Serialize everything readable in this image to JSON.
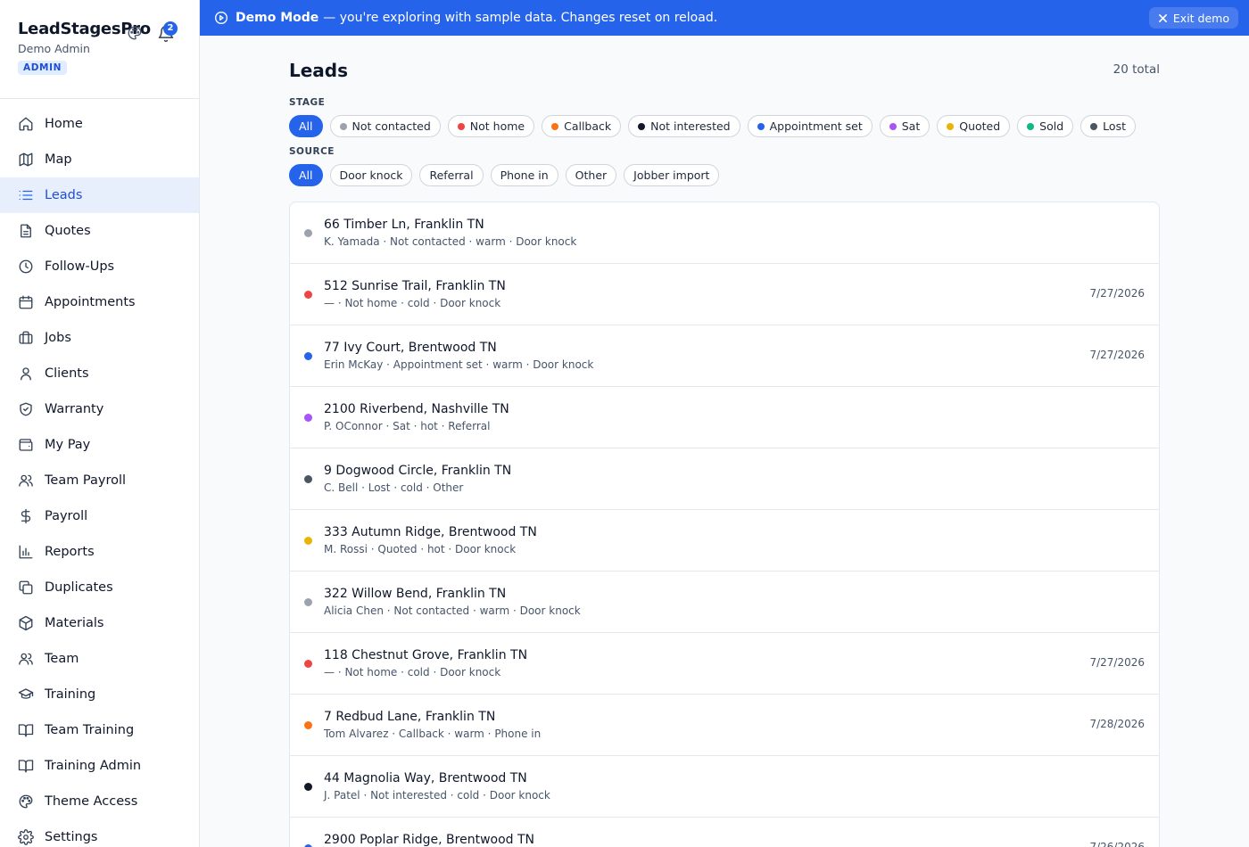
{
  "brand": {
    "title": "LeadStagesPro",
    "user": "Demo Admin",
    "role": "ADMIN",
    "notifications": "2"
  },
  "nav": [
    {
      "label": "Home",
      "icon": "home-icon"
    },
    {
      "label": "Map",
      "icon": "map-icon"
    },
    {
      "label": "Leads",
      "icon": "list-icon",
      "active": true
    },
    {
      "label": "Quotes",
      "icon": "document-icon"
    },
    {
      "label": "Follow-Ups",
      "icon": "clock-icon"
    },
    {
      "label": "Appointments",
      "icon": "calendar-icon"
    },
    {
      "label": "Jobs",
      "icon": "briefcase-icon"
    },
    {
      "label": "Clients",
      "icon": "user-icon"
    },
    {
      "label": "Warranty",
      "icon": "shield-check-icon"
    },
    {
      "label": "My Pay",
      "icon": "wallet-icon"
    },
    {
      "label": "Team Payroll",
      "icon": "users-icon"
    },
    {
      "label": "Payroll",
      "icon": "dollar-icon"
    },
    {
      "label": "Reports",
      "icon": "bar-chart-icon"
    },
    {
      "label": "Duplicates",
      "icon": "copy-icon"
    },
    {
      "label": "Materials",
      "icon": "package-icon"
    },
    {
      "label": "Team",
      "icon": "users-icon"
    },
    {
      "label": "Training",
      "icon": "graduation-cap-icon"
    },
    {
      "label": "Team Training",
      "icon": "book-open-icon"
    },
    {
      "label": "Training Admin",
      "icon": "book-open-icon"
    },
    {
      "label": "Theme Access",
      "icon": "palette-icon"
    },
    {
      "label": "Settings",
      "icon": "gear-icon"
    }
  ],
  "banner": {
    "title": "Demo Mode",
    "message": "— you're exploring with sample data. Changes reset on reload.",
    "exit_label": "Exit demo"
  },
  "page": {
    "title": "Leads",
    "total": "20 total"
  },
  "filters": {
    "stage_label": "STAGE",
    "source_label": "SOURCE",
    "stages": [
      {
        "label": "All",
        "active": true
      },
      {
        "label": "Not contacted",
        "color": "#9ca3af"
      },
      {
        "label": "Not home",
        "color": "#ef4444"
      },
      {
        "label": "Callback",
        "color": "#f97316"
      },
      {
        "label": "Not interested",
        "color": "#111827"
      },
      {
        "label": "Appointment set",
        "color": "#2563eb"
      },
      {
        "label": "Sat",
        "color": "#a855f7"
      },
      {
        "label": "Quoted",
        "color": "#eab308"
      },
      {
        "label": "Sold",
        "color": "#10b981"
      },
      {
        "label": "Lost",
        "color": "#4b5563"
      }
    ],
    "sources": [
      {
        "label": "All",
        "active": true
      },
      {
        "label": "Door knock"
      },
      {
        "label": "Referral"
      },
      {
        "label": "Phone in"
      },
      {
        "label": "Other"
      },
      {
        "label": "Jobber import"
      }
    ]
  },
  "leads": [
    {
      "address": "66 Timber Ln, Franklin TN",
      "meta": "K. Yamada · Not contacted · warm · Door knock",
      "date": "",
      "color": "#9ca3af"
    },
    {
      "address": "512 Sunrise Trail, Franklin TN",
      "meta": "— · Not home · cold · Door knock",
      "date": "7/27/2026",
      "color": "#ef4444"
    },
    {
      "address": "77 Ivy Court, Brentwood TN",
      "meta": "Erin McKay · Appointment set · warm · Door knock",
      "date": "7/27/2026",
      "color": "#2563eb"
    },
    {
      "address": "2100 Riverbend, Nashville TN",
      "meta": "P. OConnor · Sat · hot · Referral",
      "date": "",
      "color": "#a855f7"
    },
    {
      "address": "9 Dogwood Circle, Franklin TN",
      "meta": "C. Bell · Lost · cold · Other",
      "date": "",
      "color": "#4b5563"
    },
    {
      "address": "333 Autumn Ridge, Brentwood TN",
      "meta": "M. Rossi · Quoted · hot · Door knock",
      "date": "",
      "color": "#eab308"
    },
    {
      "address": "322 Willow Bend, Franklin TN",
      "meta": "Alicia Chen · Not contacted · warm · Door knock",
      "date": "",
      "color": "#9ca3af"
    },
    {
      "address": "118 Chestnut Grove, Franklin TN",
      "meta": "— · Not home · cold · Door knock",
      "date": "7/27/2026",
      "color": "#ef4444"
    },
    {
      "address": "7 Redbud Lane, Franklin TN",
      "meta": "Tom Alvarez · Callback · warm · Phone in",
      "date": "7/28/2026",
      "color": "#f97316"
    },
    {
      "address": "44 Magnolia Way, Brentwood TN",
      "meta": "J. Patel · Not interested · cold · Door knock",
      "date": "",
      "color": "#111827"
    },
    {
      "address": "2900 Poplar Ridge, Brentwood TN",
      "meta": "",
      "date": "7/26/2026",
      "color": "#2563eb"
    }
  ]
}
